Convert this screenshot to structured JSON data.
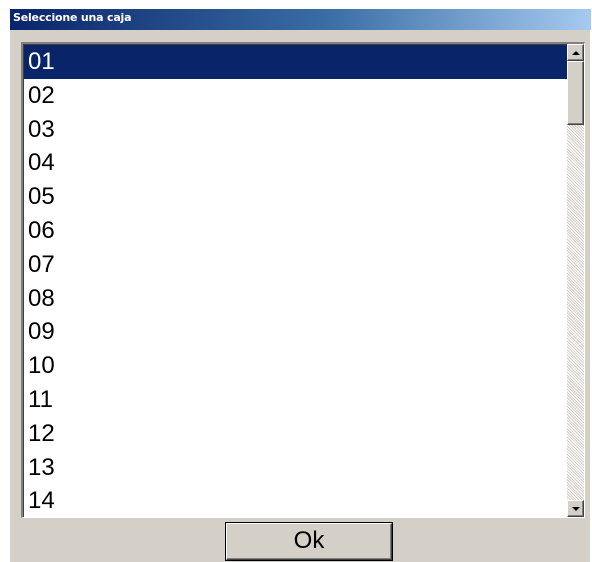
{
  "window": {
    "title": "Seleccione una caja"
  },
  "list": {
    "selected_index": 0,
    "items": [
      "01",
      "02",
      "03",
      "04",
      "05",
      "06",
      "07",
      "08",
      "09",
      "10",
      "11",
      "12",
      "13",
      "14"
    ]
  },
  "buttons": {
    "ok_label": "Ok"
  },
  "colors": {
    "title_gradient_start": "#0a246a",
    "title_gradient_end": "#a6caf0",
    "selection_background": "#0a246a",
    "dialog_background": "#d4d0c8"
  }
}
